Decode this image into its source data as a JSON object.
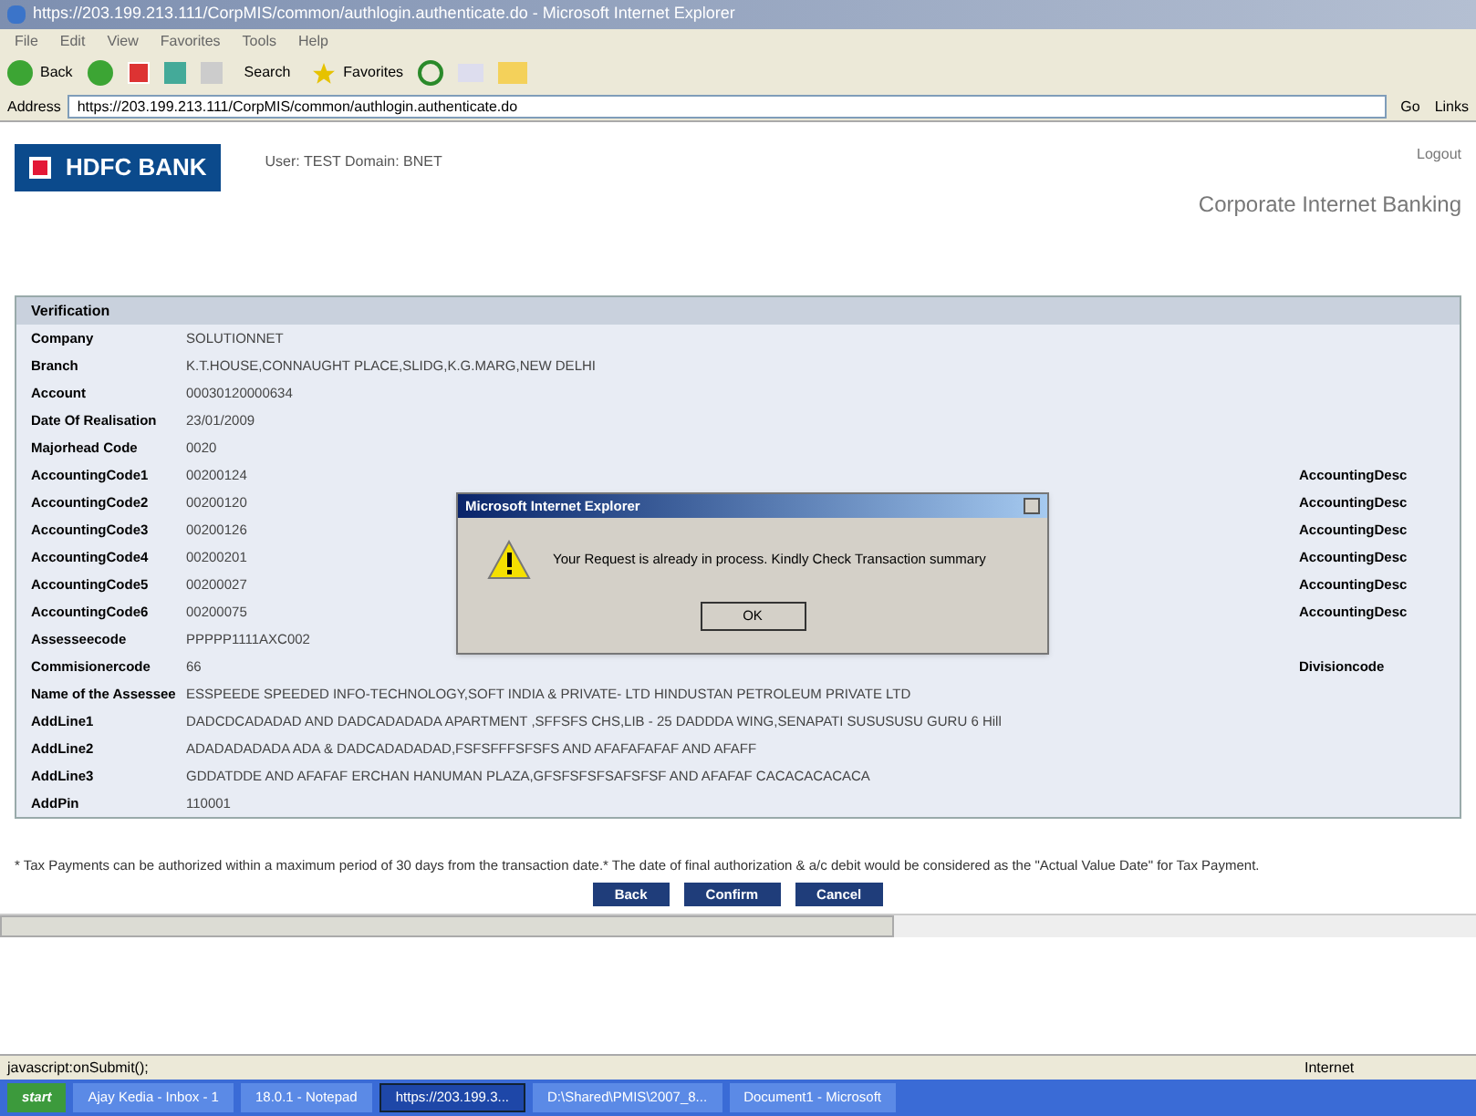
{
  "window": {
    "title": "https://203.199.213.111/CorpMIS/common/authlogin.authenticate.do - Microsoft Internet Explorer"
  },
  "menu": [
    "File",
    "Edit",
    "View",
    "Favorites",
    "Tools",
    "Help"
  ],
  "toolbar": {
    "back": "Back",
    "search": "Search",
    "favorites": "Favorites"
  },
  "address": {
    "label": "Address",
    "url": "https://203.199.213.111/CorpMIS/common/authlogin.authenticate.do",
    "go": "Go",
    "links": "Links"
  },
  "header": {
    "logo": "HDFC BANK",
    "user_line": "User: TEST  Domain: BNET",
    "logout": "Logout",
    "product": "Corporate Internet Banking"
  },
  "section": {
    "title": "Verification"
  },
  "rows": [
    {
      "label": "Company",
      "value": "SOLUTIONNET"
    },
    {
      "label": "Branch",
      "value": "K.T.HOUSE,CONNAUGHT PLACE,SLIDG,K.G.MARG,NEW DELHI"
    },
    {
      "label": "Account",
      "value": "00030120000634"
    },
    {
      "label": "Date Of Realisation",
      "value": "23/01/2009"
    },
    {
      "label": "Majorhead Code",
      "value": "0020"
    },
    {
      "label": "AccountingCode1",
      "value": "00200124",
      "right": "AccountingDesc"
    },
    {
      "label": "AccountingCode2",
      "value": "00200120",
      "right": "AccountingDesc"
    },
    {
      "label": "AccountingCode3",
      "value": "00200126",
      "right": "AccountingDesc"
    },
    {
      "label": "AccountingCode4",
      "value": "00200201",
      "right": "AccountingDesc"
    },
    {
      "label": "AccountingCode5",
      "value": "00200027",
      "right": "AccountingDesc"
    },
    {
      "label": "AccountingCode6",
      "value": "00200075",
      "right": "AccountingDesc"
    },
    {
      "label": "Assesseecode",
      "value": "PPPPP1111AXC002"
    },
    {
      "label": "Commisionercode",
      "value": "66",
      "right": "Divisioncode"
    },
    {
      "label": "Name of the Assessee",
      "value": "ESSPEEDE SPEEDED INFO-TECHNOLOGY,SOFT INDIA & PRIVATE- LTD HINDUSTAN PETROLEUM PRIVATE LTD"
    },
    {
      "label": "AddLine1",
      "value": "DADCDCADADAD AND DADCADADADA APARTMENT ,SFFSFS CHS,LIB - 25 DADDDA WING,SENAPATI SUSUSUSU GURU 6 Hill"
    },
    {
      "label": "AddLine2",
      "value": "ADADADADADA ADA & DADCADADADAD,FSFSFFFSFSFS AND AFAFAFAFAF AND AFAFF"
    },
    {
      "label": "AddLine3",
      "value": "GDDATDDE AND AFAFAF ERCHAN HANUMAN PLAZA,GFSFSFSFSAFSFSF AND AFAFAF CACACACACACA"
    },
    {
      "label": "AddPin",
      "value": "110001"
    }
  ],
  "footnote": "* Tax Payments can be authorized within a maximum period of 30 days from the transaction date.* The date of final authorization & a/c debit would be considered as the \"Actual Value Date\" for Tax Payment.",
  "buttons": [
    "Back",
    "Confirm",
    "Cancel"
  ],
  "dialog": {
    "title": "Microsoft Internet Explorer",
    "message": "Your Request is already in process. Kindly Check Transaction summary",
    "ok": "OK"
  },
  "status_bar": {
    "text": "javascript:onSubmit();",
    "zone": "Internet"
  },
  "taskbar": {
    "start": "start",
    "tasks": [
      {
        "label": "Ajay Kedia - Inbox - 1",
        "selected": false
      },
      {
        "label": "18.0.1 - Notepad",
        "selected": false
      },
      {
        "label": "https://203.199.3...",
        "selected": true
      },
      {
        "label": "D:\\Shared\\PMIS\\2007_8...",
        "selected": false
      },
      {
        "label": "Document1 - Microsoft",
        "selected": false
      }
    ]
  }
}
